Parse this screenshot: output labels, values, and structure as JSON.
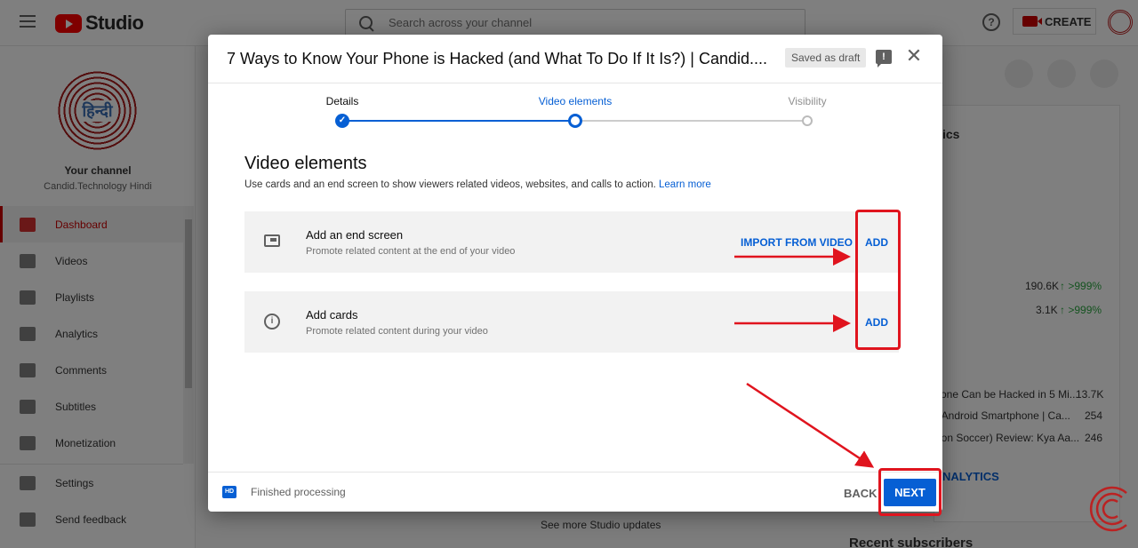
{
  "app": {
    "logo_text": "Studio",
    "search_placeholder": "Search across your channel",
    "create_label": "CREATE"
  },
  "sidebar": {
    "avatar_text": "हिन्दी",
    "your_channel": "Your channel",
    "channel_name": "Candid.Technology Hindi",
    "items": [
      {
        "label": "Dashboard",
        "icon": "dashboard-icon",
        "active": true
      },
      {
        "label": "Videos",
        "icon": "videos-icon"
      },
      {
        "label": "Playlists",
        "icon": "playlists-icon"
      },
      {
        "label": "Analytics",
        "icon": "analytics-icon"
      },
      {
        "label": "Comments",
        "icon": "comments-icon"
      },
      {
        "label": "Subtitles",
        "icon": "subtitles-icon"
      },
      {
        "label": "Monetization",
        "icon": "dollar-icon"
      }
    ],
    "bottom_items": [
      {
        "label": "Settings",
        "icon": "gear-icon"
      },
      {
        "label": "Send feedback",
        "icon": "feedback-icon"
      }
    ]
  },
  "background": {
    "panel_heading": "ics",
    "stat_rows": [
      {
        "value": "190.6K",
        "delta": ">999%"
      },
      {
        "value": "3.1K",
        "delta": ">999%"
      }
    ],
    "top_videos": [
      {
        "title": "one Can be Hacked in 5 Mi...",
        "views": "13.7K"
      },
      {
        "title": "r Android Smartphone | Ca...",
        "views": "254"
      },
      {
        "title": "ion Soccer) Review: Kya Aa...",
        "views": "246"
      }
    ],
    "analytics_link": "NALYTICS",
    "studio_updates": "See more Studio updates",
    "recent_subscribers": "Recent subscribers"
  },
  "dialog": {
    "title": "7 Ways to Know Your Phone is Hacked (and What To Do If It Is?) | Candid....",
    "draft_badge": "Saved as draft",
    "steps": [
      {
        "label": "Details",
        "state": "done"
      },
      {
        "label": "Video elements",
        "state": "current"
      },
      {
        "label": "Visibility",
        "state": "pending"
      }
    ],
    "section_title": "Video elements",
    "section_desc": "Use cards and an end screen to show viewers related videos, websites, and calls to action.",
    "learn_more": "Learn more",
    "end_screen": {
      "title": "Add an end screen",
      "subtitle": "Promote related content at the end of your video",
      "import_label": "IMPORT FROM VIDEO",
      "add_label": "ADD"
    },
    "cards": {
      "title": "Add cards",
      "subtitle": "Promote related content during your video",
      "add_label": "ADD"
    },
    "footer": {
      "hd_label": "HD",
      "status": "Finished processing",
      "back_label": "BACK",
      "next_label": "NEXT"
    }
  },
  "colors": {
    "accent": "#065fd4",
    "annotation": "#e0141e",
    "brand_red": "#ff0000"
  }
}
